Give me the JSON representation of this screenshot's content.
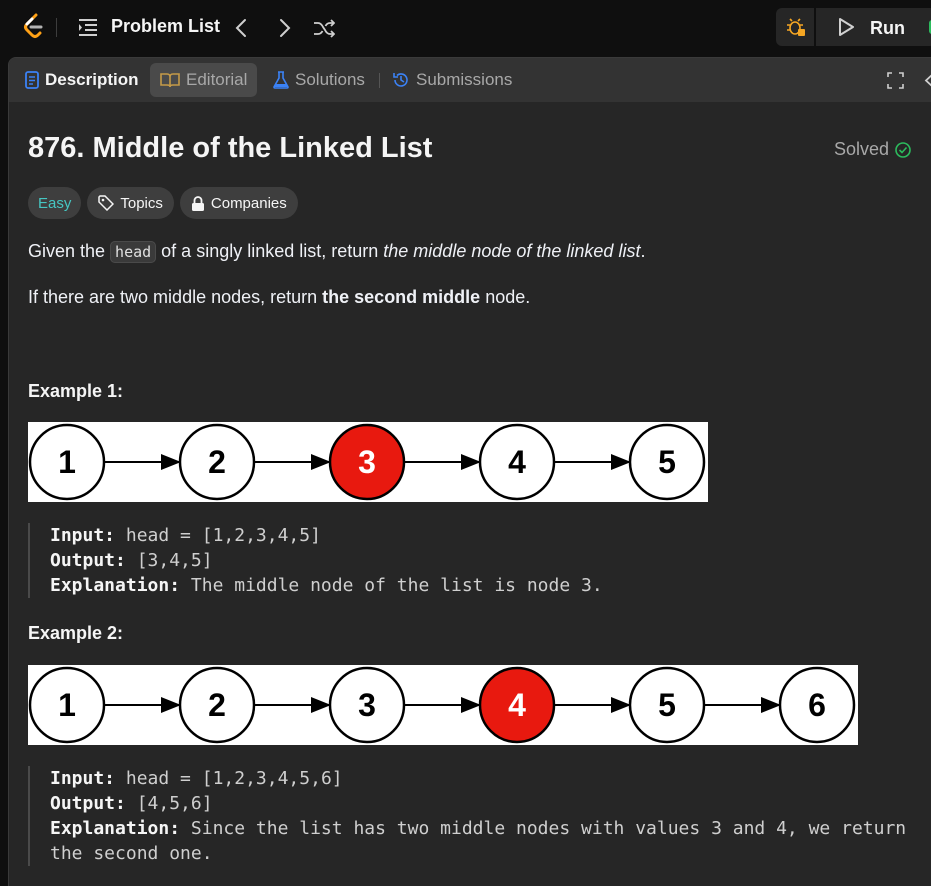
{
  "topbar": {
    "problem_list_label": "Problem List",
    "run_label": "Run"
  },
  "tabs": [
    {
      "label": "Description",
      "active": true
    },
    {
      "label": "Editorial"
    },
    {
      "label": "Solutions"
    },
    {
      "label": "Submissions"
    }
  ],
  "problem": {
    "title": "876. Middle of the Linked List",
    "status": "Solved",
    "difficulty": "Easy",
    "topics_label": "Topics",
    "companies_label": "Companies"
  },
  "description": {
    "p1_pre": "Given the ",
    "p1_code": "head",
    "p1_mid": " of a singly linked list, return ",
    "p1_italic": "the middle node of the linked list",
    "p1_end": ".",
    "p2_pre": "If there are two middle nodes, return ",
    "p2_bold": "the second middle",
    "p2_end": " node."
  },
  "examples": [
    {
      "title": "Example 1:",
      "nodes": [
        "1",
        "2",
        "3",
        "4",
        "5"
      ],
      "highlight_index": 2,
      "input_label": "Input:",
      "input": "head = [1,2,3,4,5]",
      "output_label": "Output:",
      "output": "[3,4,5]",
      "explanation_label": "Explanation:",
      "explanation": "The middle node of the list is node 3.",
      "explanation_cont": ""
    },
    {
      "title": "Example 2:",
      "nodes": [
        "1",
        "2",
        "3",
        "4",
        "5",
        "6"
      ],
      "highlight_index": 3,
      "input_label": "Input:",
      "input": "head = [1,2,3,4,5,6]",
      "output_label": "Output:",
      "output": "[4,5,6]",
      "explanation_label": "Explanation:",
      "explanation": "Since the list has two middle nodes with values 3 and 4, we return",
      "explanation_cont": "the second one."
    }
  ],
  "colors": {
    "easy": "#46c6c2",
    "solved_check": "#2cbb5d",
    "highlight_node": "#e8190f"
  },
  "icons": [
    "leetcode-logo-icon",
    "list-icon",
    "chevron-left-icon",
    "chevron-right-icon",
    "shuffle-icon",
    "debug-icon",
    "play-icon",
    "description-icon",
    "book-icon",
    "flask-icon",
    "history-icon",
    "expand-icon",
    "check-circle-icon",
    "tag-icon",
    "lock-icon"
  ]
}
